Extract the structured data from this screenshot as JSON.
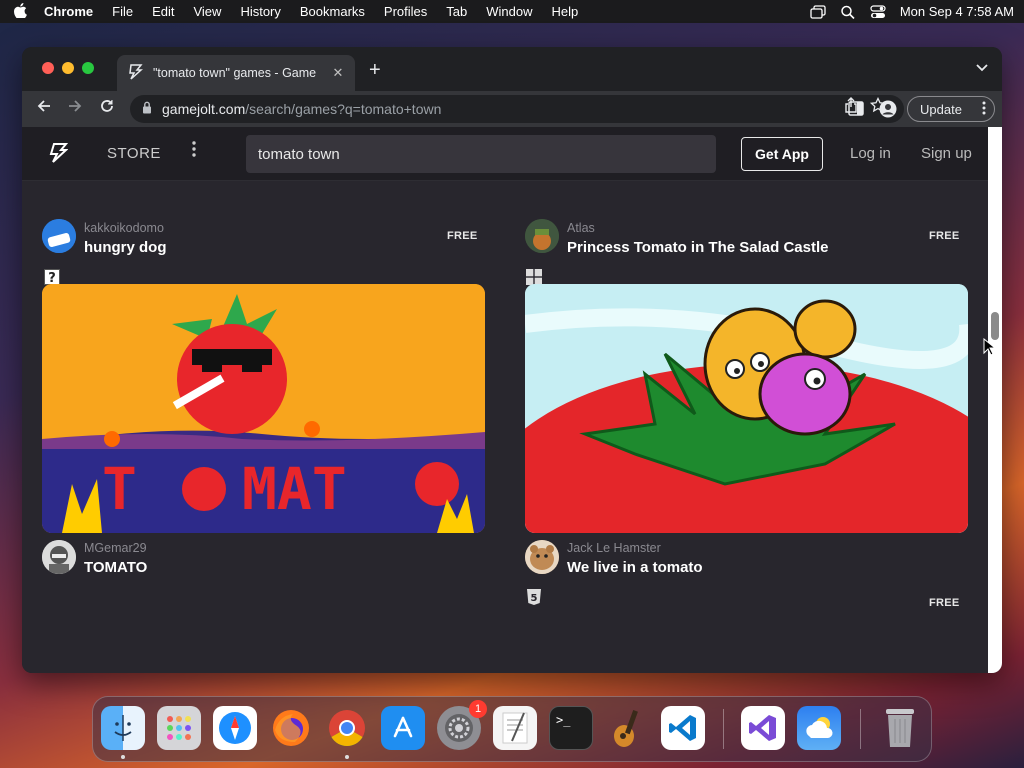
{
  "menubar": {
    "apple": "",
    "app": "Chrome",
    "items": [
      "File",
      "Edit",
      "View",
      "History",
      "Bookmarks",
      "Profiles",
      "Tab",
      "Window",
      "Help"
    ],
    "clock": "Mon Sep 4  7:58 AM"
  },
  "browser": {
    "tab_title": "\"tomato town\" games - Game",
    "url_host": "gamejolt.com",
    "url_path": "/search/games?q=tomato+town",
    "update_label": "Update"
  },
  "site": {
    "logo": "⚡",
    "store_label": "STORE",
    "search_value": "tomato town",
    "get_app": "Get App",
    "login": "Log in",
    "signup": "Sign up"
  },
  "games": [
    {
      "author": "kakkoikodomo",
      "title": "hungry dog",
      "price": "FREE",
      "platform": "unknown-platform-icon"
    },
    {
      "author": "Atlas",
      "title": "Princess Tomato in The Salad Castle",
      "price": "FREE",
      "platform": "windows-icon"
    },
    {
      "author": "MGemar29",
      "title": "TOMATO",
      "price": "",
      "platform": ""
    },
    {
      "author": "Jack Le Hamster",
      "title": "We live in a tomato",
      "price": "FREE",
      "platform": "html5-icon"
    }
  ],
  "thumb_text": {
    "tomato_game": "T MAT "
  },
  "dock": {
    "items": [
      "Finder",
      "Launchpad",
      "Safari",
      "Firefox",
      "Chrome",
      "App Store",
      "System Settings",
      "TextEdit",
      "Terminal",
      "GarageBand",
      "VS Code",
      "Visual Studio",
      "Weather",
      "Trash"
    ],
    "settings_badge": "1",
    "terminal_prompt": ">_"
  }
}
